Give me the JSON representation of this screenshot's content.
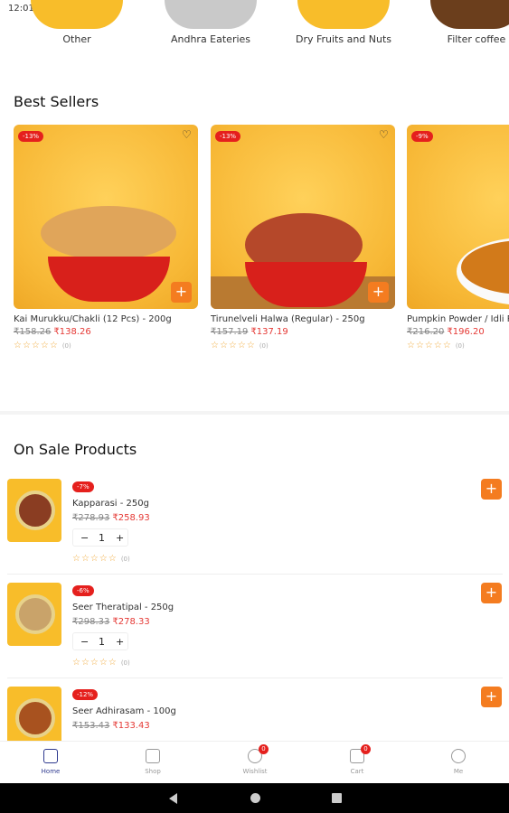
{
  "status_bar": {
    "time": "12:01"
  },
  "categories": [
    {
      "label": "Other"
    },
    {
      "label": "Andhra Eateries"
    },
    {
      "label": "Dry Fruits and Nuts"
    },
    {
      "label": "Filter coffee"
    }
  ],
  "best_sellers": {
    "title": "Best Sellers",
    "items": [
      {
        "discount": "-13%",
        "name": "Kai Murukku/Chakli (12 Pcs) -   200g",
        "old_price": "₹158.26",
        "new_price": "₹138.26",
        "rating_count": "(0)"
      },
      {
        "discount": "-13%",
        "name": "Tirunelveli Halwa (Regular) -   250g",
        "old_price": "₹157.19",
        "new_price": "₹137.19",
        "rating_count": "(0)"
      },
      {
        "discount": "-9%",
        "name": "Pumpkin Powder / Idli Podi",
        "old_price": "₹216.20",
        "new_price": "₹196.20",
        "rating_count": "(0)"
      }
    ]
  },
  "on_sale": {
    "title": "On Sale Products",
    "items": [
      {
        "discount": "-7%",
        "name": "Kapparasi -   250g",
        "old_price": "₹278.93",
        "new_price": "₹258.93",
        "qty": "1",
        "rating_count": "(0)"
      },
      {
        "discount": "-6%",
        "name": "Seer Theratipal -   250g",
        "old_price": "₹298.33",
        "new_price": "₹278.33",
        "qty": "1",
        "rating_count": "(0)"
      },
      {
        "discount": "-12%",
        "name": "Seer Adhirasam -   100g",
        "old_price": "₹153.43",
        "new_price": "₹133.43"
      }
    ]
  },
  "bottom_nav": [
    {
      "label": "Home",
      "icon": "home-icon"
    },
    {
      "label": "Shop",
      "icon": "shop-icon"
    },
    {
      "label": "Wishlist",
      "icon": "heart-icon",
      "badge": "0"
    },
    {
      "label": "Cart",
      "icon": "cart-icon",
      "badge": "0"
    },
    {
      "label": "Me",
      "icon": "user-icon"
    }
  ],
  "glyphs": {
    "add": "+",
    "minus": "−",
    "plus": "+",
    "heart": "♡",
    "stars": "☆☆☆☆☆"
  },
  "colors": {
    "accent": "#f47c20",
    "discount": "#e5201d",
    "card_bg": "#f8bd2a",
    "active_nav": "#2f3a8f"
  }
}
